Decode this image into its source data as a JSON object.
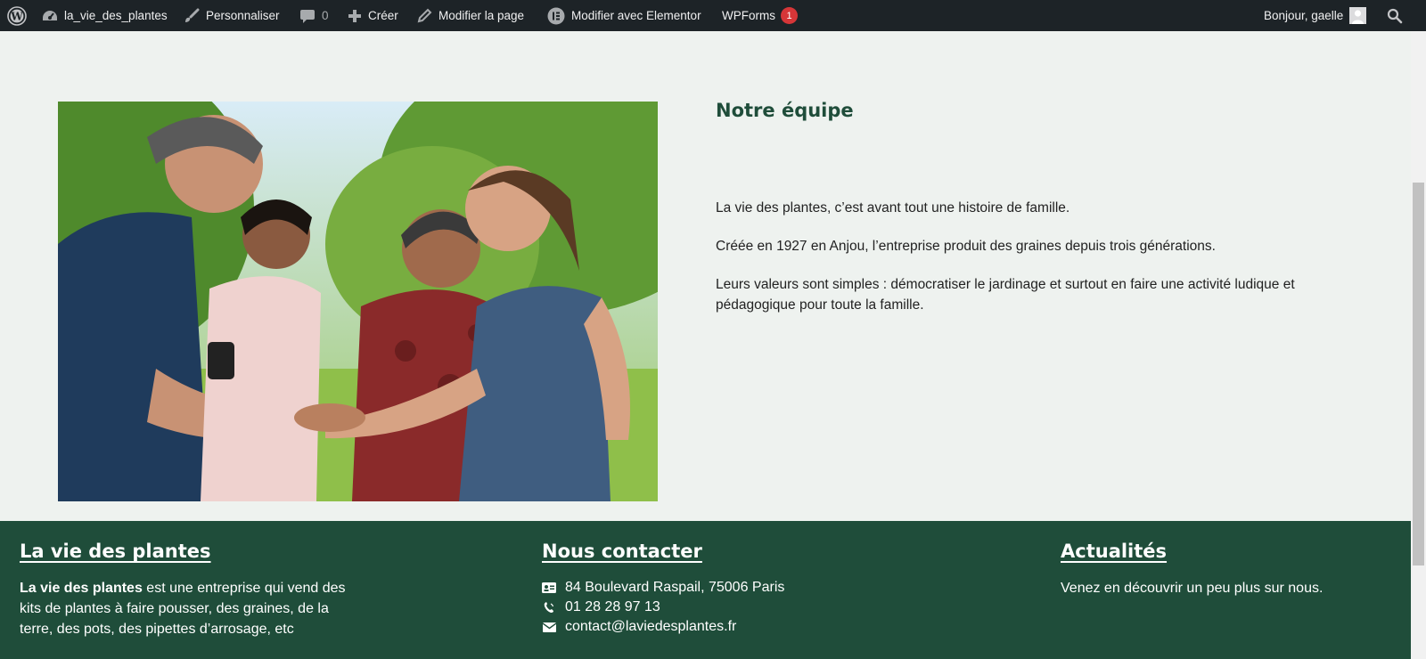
{
  "adminbar": {
    "site_name": "la_vie_des_plantes",
    "customize": "Personnaliser",
    "comments_count": "0",
    "new": "Créer",
    "edit_page": "Modifier la page",
    "elementor": "Modifier avec Elementor",
    "wpforms": "WPForms",
    "wpforms_badge": "1",
    "greeting": "Bonjour, gaelle"
  },
  "about": {
    "title": "Notre équipe",
    "paragraphs": [
      "La vie des plantes, c’est avant tout une histoire de famille.",
      "Créée en 1927 en Anjou, l’entreprise produit des graines depuis trois générations.",
      "Leurs valeurs sont simples : démocratiser le jardinage et surtout en faire une activité ludique et pédagogique pour toute la famille."
    ]
  },
  "footer": {
    "col1": {
      "title": "La vie des plantes",
      "bold": "La vie des plantes",
      "text": " est une entreprise qui vend des kits de plantes à faire pousser, des graines, de la terre, des pots, des pipettes d’arrosage, etc"
    },
    "col2": {
      "title": "Nous contacter",
      "address": "84 Boulevard Raspail, 75006 Paris",
      "phone": "01 28 28 97 13",
      "email": "contact@laviedesplantes.fr"
    },
    "col3": {
      "title": "Actualités",
      "text": "Venez en découvrir un peu plus sur nous."
    }
  },
  "colors": {
    "adminbar": "#1d2327",
    "page_bg": "#eef2ef",
    "footer_bg": "#1f4d3a",
    "heading": "#1f4d3a"
  }
}
